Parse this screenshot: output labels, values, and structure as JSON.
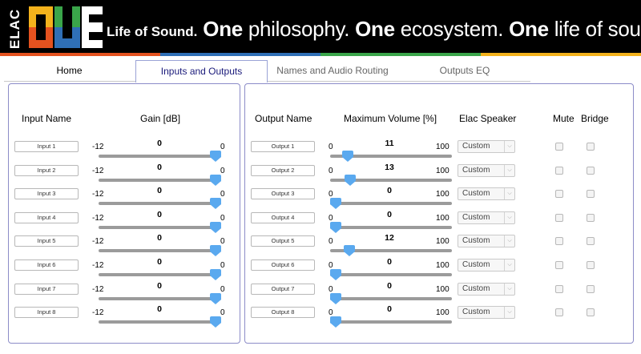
{
  "banner": {
    "brand_top": "ELAC",
    "brand_main": "ONE",
    "tagline_lead": "Life of Sound.",
    "tagline_w1": "One",
    "tagline_t1": " philosophy. ",
    "tagline_w2": "One",
    "tagline_t2": " ecosystem. ",
    "tagline_w3": "One",
    "tagline_t3": " life of sound."
  },
  "tabs": [
    "Home",
    "Inputs and Outputs",
    "Names and Audio Routing",
    "Outputs EQ"
  ],
  "active_tab": "Inputs and Outputs",
  "inputs": {
    "col_name": "Input Name",
    "col_gain": "Gain [dB]",
    "min_label": "-12",
    "max_label": "0",
    "rows": [
      {
        "name": "Input 1",
        "value": "0"
      },
      {
        "name": "Input 2",
        "value": "0"
      },
      {
        "name": "Input 3",
        "value": "0"
      },
      {
        "name": "Input 4",
        "value": "0"
      },
      {
        "name": "Input 5",
        "value": "0"
      },
      {
        "name": "Input 6",
        "value": "0"
      },
      {
        "name": "Input 7",
        "value": "0"
      },
      {
        "name": "Input 8",
        "value": "0"
      }
    ]
  },
  "outputs": {
    "col_name": "Output Name",
    "col_volume": "Maximum Volume [%]",
    "col_speaker": "Elac Speaker",
    "col_mute": "Mute",
    "col_bridge": "Bridge",
    "min_label": "0",
    "max_label": "100",
    "rows": [
      {
        "name": "Output 1",
        "value": "11",
        "speaker": "Custom",
        "mute": false,
        "bridge": false
      },
      {
        "name": "Output 2",
        "value": "13",
        "speaker": "Custom",
        "mute": false,
        "bridge": false
      },
      {
        "name": "Output 3",
        "value": "0",
        "speaker": "Custom",
        "mute": false,
        "bridge": false
      },
      {
        "name": "Output 4",
        "value": "0",
        "speaker": "Custom",
        "mute": false,
        "bridge": false
      },
      {
        "name": "Output 5",
        "value": "12",
        "speaker": "Custom",
        "mute": false,
        "bridge": false
      },
      {
        "name": "Output 6",
        "value": "0",
        "speaker": "Custom",
        "mute": false,
        "bridge": false
      },
      {
        "name": "Output 7",
        "value": "0",
        "speaker": "Custom",
        "mute": false,
        "bridge": false
      },
      {
        "name": "Output 8",
        "value": "0",
        "speaker": "Custom",
        "mute": false,
        "bridge": false
      }
    ]
  },
  "colors": {
    "accent": "#5aa9ef",
    "panel_border": "#8c8cc8",
    "active_tab_text": "#1a1a7a"
  },
  "icons": {
    "dropdown": "chevron-down-icon"
  }
}
